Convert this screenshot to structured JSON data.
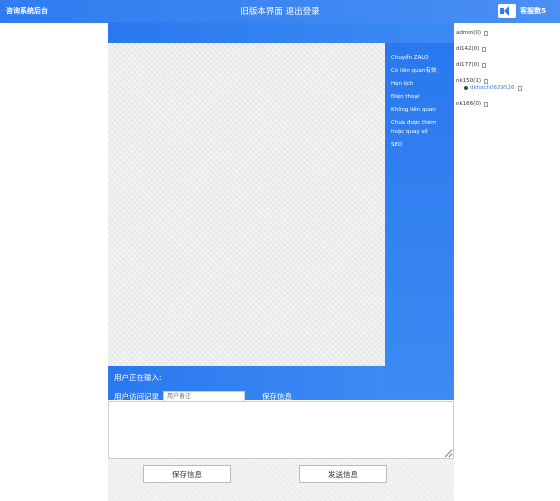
{
  "header": {
    "brand": "咨询系统后台",
    "old_ui": "旧版本界面",
    "logout": "退出登录",
    "service_count": "客服数5"
  },
  "side_menu": [
    "Chuyển ZALO",
    "Có liên quan有效",
    "Hẹn lịch",
    "Điện thoại",
    "Không liên quan",
    "Chưa được thêm",
    "hoặc quay số",
    "SEO"
  ],
  "input_bar": {
    "typing": "用户正在输入:",
    "visit_record": "用户访问记录",
    "remark_placeholder": "用户备注",
    "save": "保存信息"
  },
  "actions": {
    "save": "保存信息",
    "send": "发送信息"
  },
  "users": [
    {
      "name": "admin(0)"
    },
    {
      "name": "dl142(0)"
    },
    {
      "name": "dl177(0)"
    },
    {
      "name": "nk150(1)",
      "child": "dkhach0629526"
    },
    {
      "name": "nk166(0)"
    }
  ]
}
